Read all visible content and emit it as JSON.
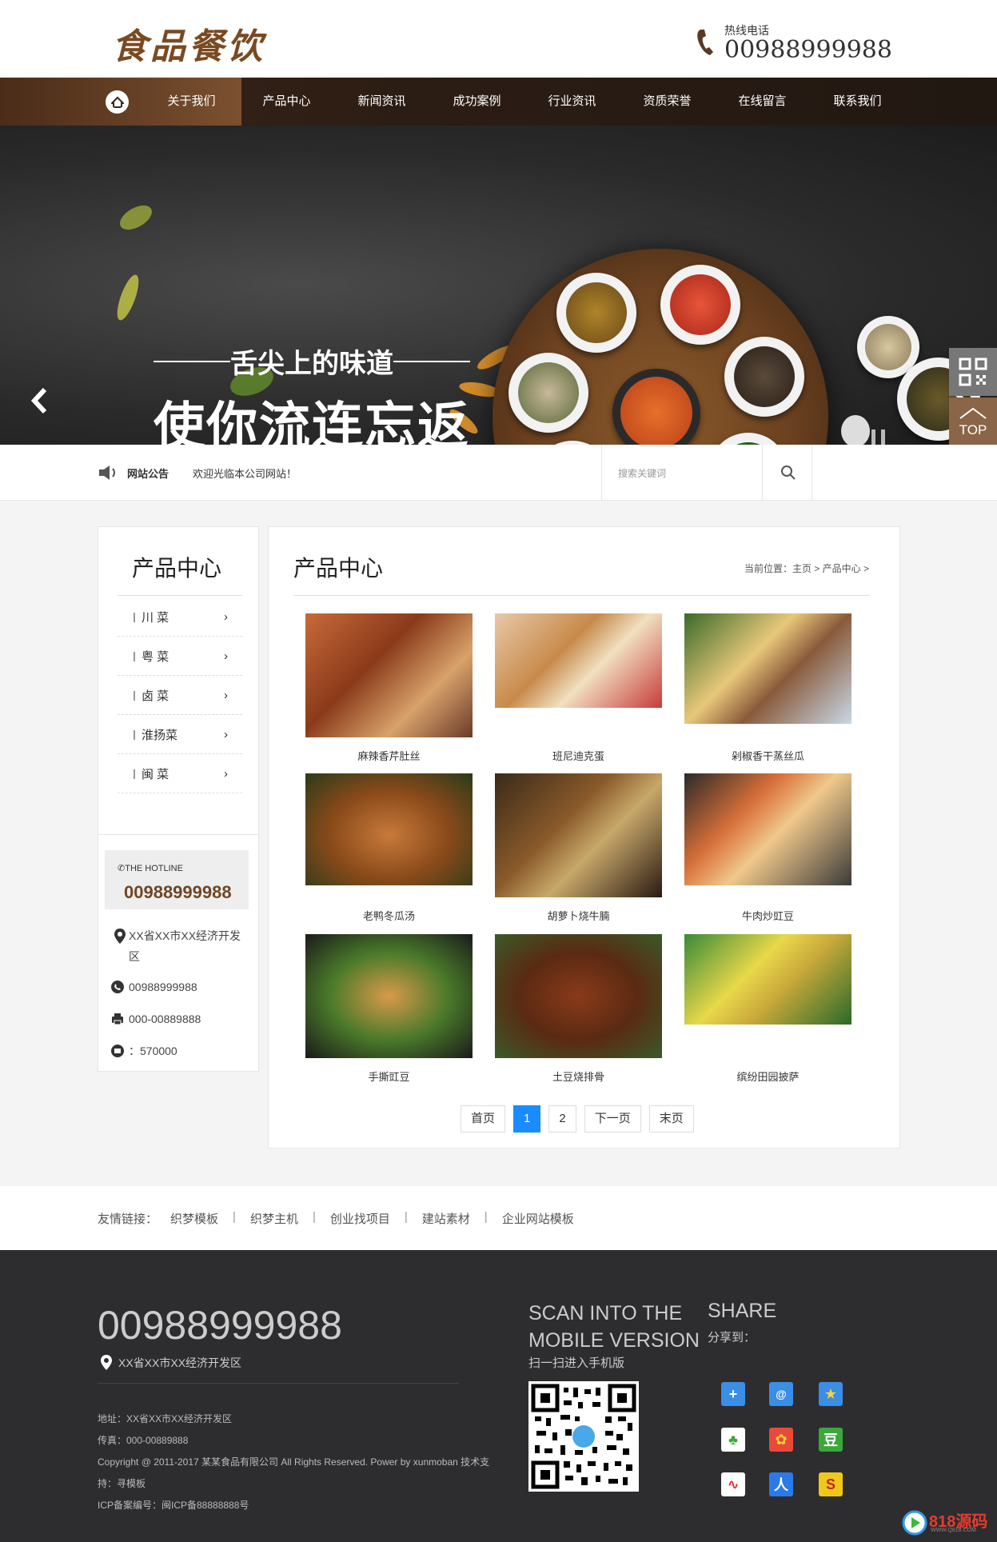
{
  "header": {
    "logo": "食品餐饮",
    "hotline_label": "热线电话",
    "hotline_number": "00988999988"
  },
  "nav": {
    "items": [
      "关于我们",
      "产品中心",
      "新闻资讯",
      "成功案例",
      "行业资讯",
      "资质荣誉",
      "在线留言",
      "联系我们"
    ]
  },
  "banner": {
    "line1": "舌尖上的味道",
    "line2": "使你流连忘返"
  },
  "float": {
    "top_label": "TOP"
  },
  "notice": {
    "title": "网站公告",
    "content": "欢迎光临本公司网站！",
    "search_placeholder": "搜索关键词"
  },
  "sidebar": {
    "title": "产品中心",
    "categories": [
      "川 菜",
      "粤 菜",
      "卤 菜",
      "淮扬菜",
      "闽 菜"
    ],
    "hotline_label": "THE HOTLINE",
    "hotline_number": "00988999988",
    "address": "XX省XX市XX经济开发区",
    "phone": "00988999988",
    "fax": "000-00889888",
    "email": "：570000"
  },
  "main": {
    "title": "产品中心",
    "breadcrumb": "当前位置：主页 > 产品中心 >",
    "products": [
      {
        "name": "麻辣香芹肚丝"
      },
      {
        "name": "班尼迪克蛋"
      },
      {
        "name": "剁椒香干蒸丝瓜"
      },
      {
        "name": "老鸭冬瓜汤"
      },
      {
        "name": "胡萝卜烧牛腩"
      },
      {
        "name": "牛肉炒豇豆"
      },
      {
        "name": "手撕豇豆"
      },
      {
        "name": "土豆烧排骨"
      },
      {
        "name": "缤纷田园披萨"
      }
    ],
    "pager": {
      "first": "首页",
      "current": "1",
      "page2": "2",
      "next": "下一页",
      "last": "末页"
    }
  },
  "links": {
    "label": "友情链接：",
    "items": [
      "织梦模板",
      "织梦主机",
      "创业找项目",
      "建站素材",
      "企业网站模板"
    ]
  },
  "footer": {
    "phone": "00988999988",
    "address": "XX省XX市XX经济开发区",
    "addr_line": "地址：XX省XX市XX经济开发区",
    "fax_line": "传真：000-00889888",
    "copyright_1": "Copyright @ 2011-2017 某某食品有限公司 All Rights Reserved. Power by xunmoban 技术支",
    "copyright_2": "持：寻模板",
    "icp": "ICP备案编号：闽ICP备88888888号",
    "scan_1": "SCAN INTO THE",
    "scan_2": "MOBILE VERSION",
    "scan_sub": "扫一扫进入手机版",
    "share": "SHARE",
    "share_sub": "分享到："
  },
  "watermark": {
    "text": "818源码",
    "sub": "WWW.Q818.COM"
  },
  "colors": {
    "brand_brown": "#7b5030",
    "nav_dark": "#2c1d14",
    "pager_active": "#1a8cff",
    "footer_bg": "#2d2d30"
  }
}
